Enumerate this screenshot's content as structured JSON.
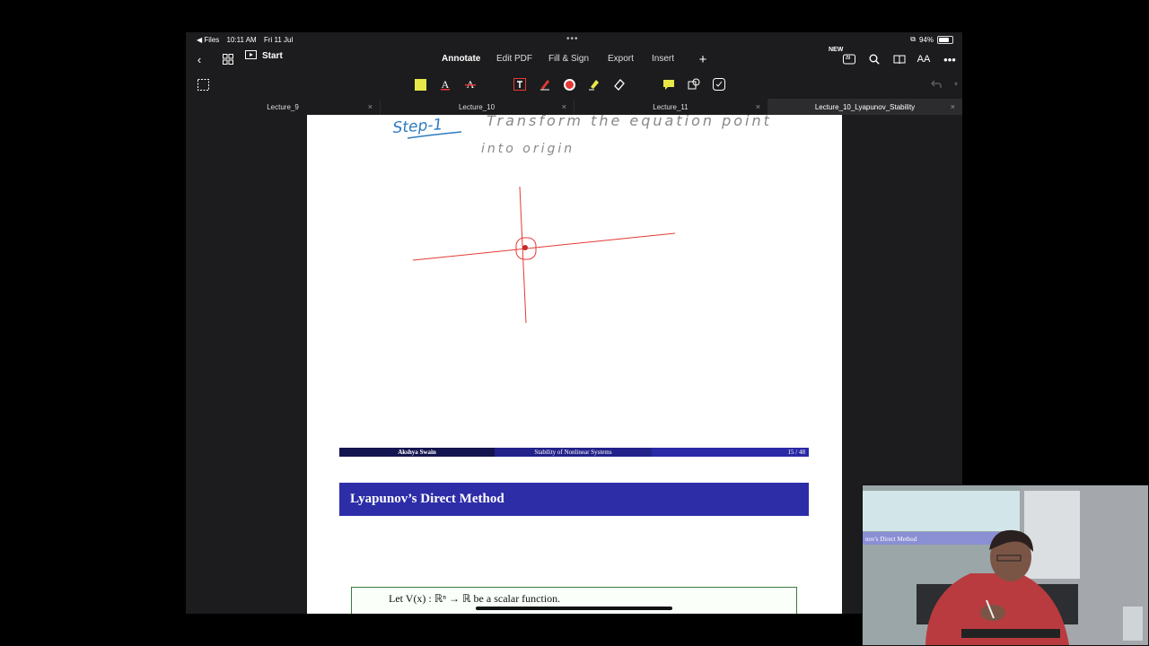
{
  "status_bar": {
    "back_app": "◀ Files",
    "time": "10:11 AM",
    "date": "Fri 11 Jul",
    "battery": "94%",
    "battery_level": 0.94
  },
  "top_bar": {
    "start_label": "Start",
    "menus": [
      "Annotate",
      "Edit PDF",
      "Fill & Sign",
      "Export",
      "Insert"
    ],
    "active_menu": "Annotate",
    "new_badge": "NEW",
    "ai_label": "ai",
    "text_size_label": "AA"
  },
  "toolbar": {
    "tools": [
      "note-yellow",
      "text-underline",
      "text-strikethrough",
      "text-box",
      "pen",
      "color-red",
      "highlighter",
      "eraser",
      "comment",
      "shapes",
      "lasso"
    ],
    "colors": {
      "yellow": "#e8e84a",
      "red": "#e53935",
      "accent": "#ff3b30"
    }
  },
  "tabs": [
    {
      "label": "Lecture_9",
      "active": false
    },
    {
      "label": "Lecture_10",
      "active": false
    },
    {
      "label": "Lecture_11",
      "active": false
    },
    {
      "label": "Lecture_10_Lyapunov_Stability",
      "active": true
    }
  ],
  "handwriting": {
    "step_label": "Step-1",
    "line1": "Transform the equation point",
    "line2": "into origin"
  },
  "slide_footer": {
    "author": "Akshya Swain",
    "title": "Stability of Nonlinear Systems",
    "page": "15 / 48"
  },
  "next_slide": {
    "title": "Lyapunov’s Direct Method",
    "definition": "Let V(x) : ℝⁿ → ℝ be a scalar function."
  },
  "video": {
    "screen_text": "nov's Direct Method"
  }
}
